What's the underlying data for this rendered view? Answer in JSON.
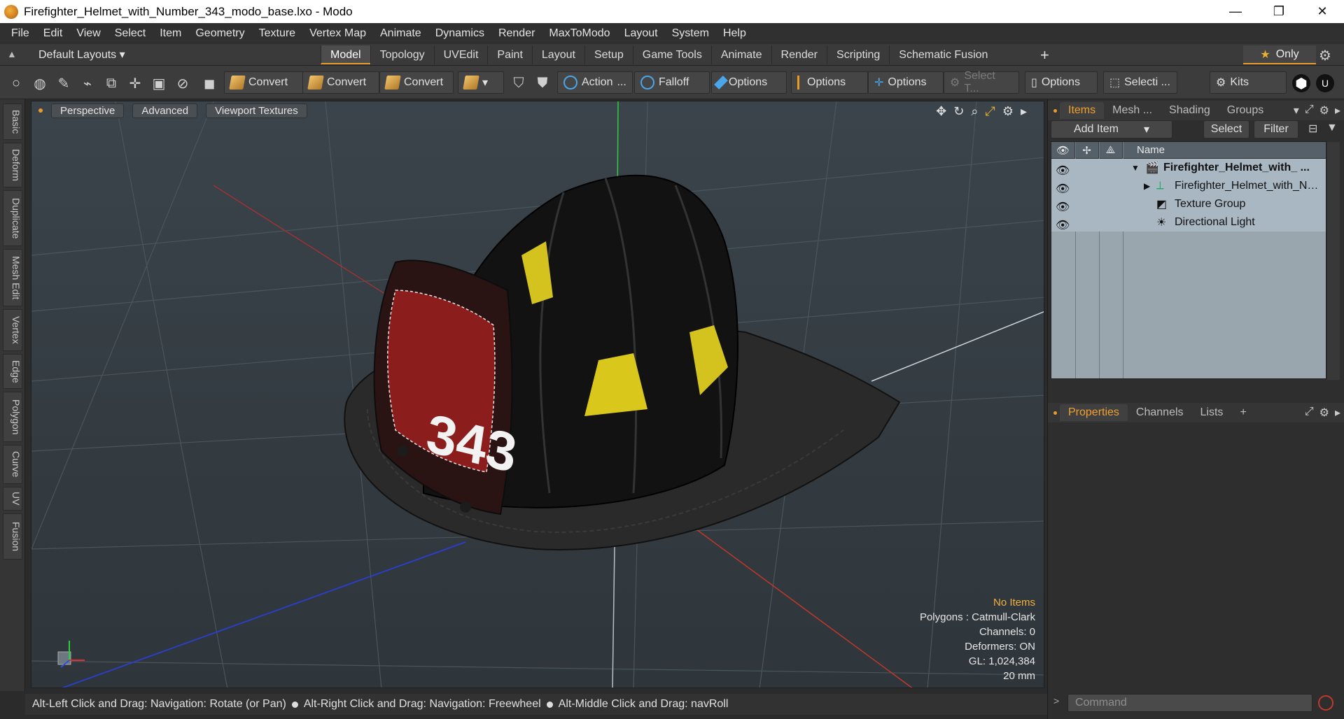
{
  "window": {
    "title": "Firefighter_Helmet_with_Number_343_modo_base.lxo - Modo",
    "minimize": "—",
    "restore": "❐",
    "close": "✕"
  },
  "menu": [
    "File",
    "Edit",
    "View",
    "Select",
    "Item",
    "Geometry",
    "Texture",
    "Vertex Map",
    "Animate",
    "Dynamics",
    "Render",
    "MaxToModo",
    "Layout",
    "System",
    "Help"
  ],
  "layout": {
    "selector": "Default Layouts ▾",
    "tabs": [
      "Model",
      "Topology",
      "UVEdit",
      "Paint",
      "Layout",
      "Setup",
      "Game Tools",
      "Animate",
      "Render",
      "Scripting",
      "Schematic Fusion"
    ],
    "active_tab": "Model",
    "plus": "+",
    "only_label": "Only"
  },
  "toolbar": {
    "convert1": "Convert",
    "convert2": "Convert",
    "convert3": "Convert",
    "action": "Action",
    "action_more": "...",
    "falloff": "Falloff",
    "options1": "Options",
    "options2": "Options",
    "options3": "Options",
    "select_t": "Select T...",
    "options4": "Options",
    "selecti": "Selecti ...",
    "kits": "Kits"
  },
  "left_tabs": [
    "Basic",
    "Deform",
    "Duplicate",
    "Mesh Edit",
    "Vertex",
    "Edge",
    "Polygon",
    "Curve",
    "UV",
    "Fusion"
  ],
  "viewport": {
    "perspective": "Perspective",
    "advanced": "Advanced",
    "viewport_textures": "Viewport Textures",
    "helmet_number": "343",
    "info": {
      "no_items": "No Items",
      "polygons": "Polygons : Catmull-Clark",
      "channels": "Channels: 0",
      "deformers": "Deformers: ON",
      "gl": "GL: 1,024,384",
      "scale": "20 mm"
    }
  },
  "status": {
    "hint1": "Alt-Left Click and Drag: Navigation: Rotate (or Pan)",
    "hint2": "Alt-Right Click and Drag: Navigation: Freewheel",
    "hint3": "Alt-Middle Click and Drag: navRoll"
  },
  "items_panel": {
    "tabs": [
      "Items",
      "Mesh ...",
      "Shading",
      "Groups"
    ],
    "active_tab": "Items",
    "add_item": "Add Item",
    "select": "Select",
    "filter": "Filter",
    "col_name": "Name",
    "rows": [
      {
        "name": "Firefighter_Helmet_with_ ...",
        "bold": true
      },
      {
        "name": "Firefighter_Helmet_with_Nu ..."
      },
      {
        "name": "Texture Group"
      },
      {
        "name": "Directional Light"
      }
    ]
  },
  "properties_panel": {
    "tabs": [
      "Properties",
      "Channels",
      "Lists"
    ],
    "active_tab": "Properties",
    "plus": "+"
  },
  "command": {
    "placeholder": "Command"
  }
}
